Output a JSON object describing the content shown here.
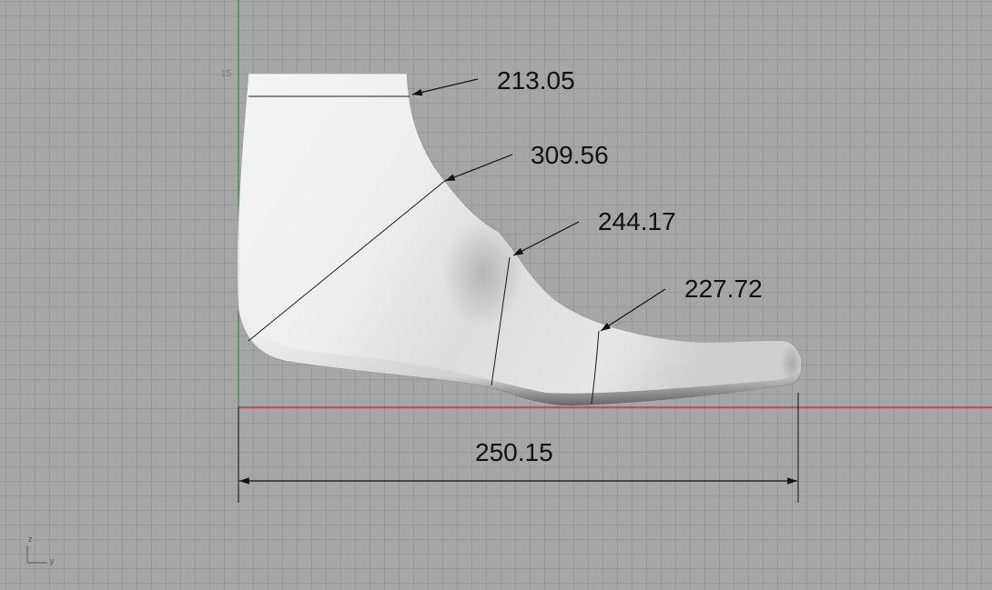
{
  "viewport": {
    "background_color": "#a6a6a6",
    "x_axis_color": "#c0272d",
    "z_axis_color": "#2e9a3a",
    "grid_label": "15"
  },
  "model": {
    "name": "foot last",
    "fill": "#ececec"
  },
  "dimensions": {
    "top_girth": "213.05",
    "instep_girth": "309.56",
    "ball_girth": "244.17",
    "toe_girth": "227.72",
    "length": "250.15"
  },
  "axis_indicator": {
    "vertical_label": "z",
    "horizontal_label": "y"
  }
}
